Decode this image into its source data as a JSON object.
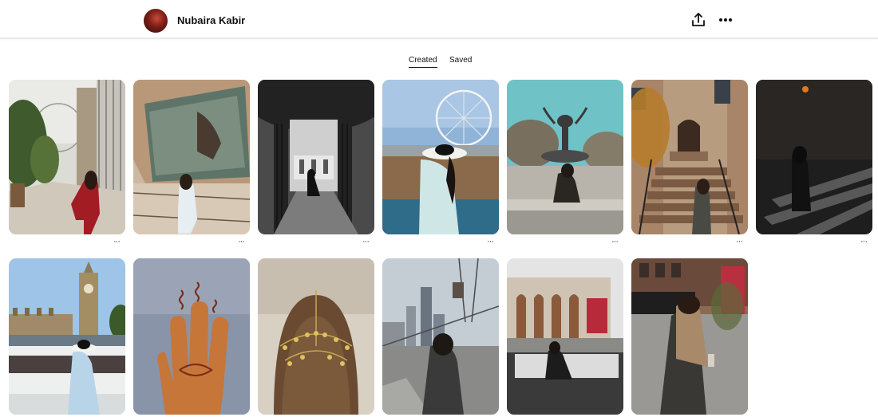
{
  "profile": {
    "name": "Nubaira Kabir",
    "avatar_icon": "profile-avatar"
  },
  "toolbar": {
    "share_icon": "share-upload-icon",
    "more_icon": "more-options-icon"
  },
  "tabs": [
    {
      "label": "Created",
      "active": true
    },
    {
      "label": "Saved",
      "active": false
    }
  ],
  "pin_more_label": "···",
  "pins": [
    {
      "subject": "london-eye-street"
    },
    {
      "subject": "museum-painting"
    },
    {
      "subject": "gate-bw"
    },
    {
      "subject": "london-eye-river"
    },
    {
      "subject": "fountain"
    },
    {
      "subject": "brownstone-stoop"
    },
    {
      "subject": "night-crosswalk"
    },
    {
      "subject": "big-ben"
    },
    {
      "subject": "henna-hand"
    },
    {
      "subject": "hair-jewelry"
    },
    {
      "subject": "nyc-bridge"
    },
    {
      "subject": "lincoln-center"
    },
    {
      "subject": "nyc-street"
    }
  ]
}
